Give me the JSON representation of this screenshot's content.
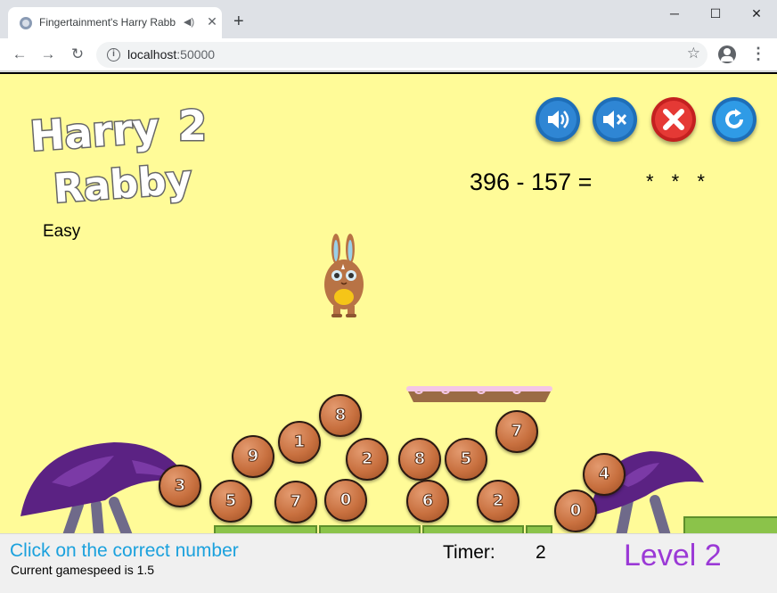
{
  "browser": {
    "tab_title": "Fingertainment's Harry Rabb",
    "tab_audio_icon": "speaker-icon",
    "url_host": "localhost",
    "url_port": ":50000"
  },
  "game": {
    "logo_line1": "Harry",
    "logo_number": "2",
    "logo_line2": "Rabby",
    "difficulty": "Easy",
    "question": "396 - 157 =",
    "lives": "* * *",
    "controls": [
      "sound-on-icon",
      "sound-off-icon",
      "close-icon",
      "restart-icon"
    ],
    "number_balls": [
      {
        "value": "8"
      },
      {
        "value": "1"
      },
      {
        "value": "9"
      },
      {
        "value": "7"
      },
      {
        "value": "2"
      },
      {
        "value": "8"
      },
      {
        "value": "5"
      },
      {
        "value": "3"
      },
      {
        "value": "5"
      },
      {
        "value": "7"
      },
      {
        "value": "0"
      },
      {
        "value": "6"
      },
      {
        "value": "2"
      },
      {
        "value": "4"
      },
      {
        "value": "0"
      }
    ]
  },
  "status": {
    "instruction": "Click on the correct number",
    "gamespeed": "Current gamespeed is 1.5",
    "timer_label": "Timer:",
    "timer_value": "2",
    "level": "Level 2"
  },
  "colors": {
    "game_background": "#fffb98",
    "instruction": "#1ba1dd",
    "level": "#9b39d6",
    "ball": "#c8703f",
    "mushroom": "#5b2283"
  }
}
